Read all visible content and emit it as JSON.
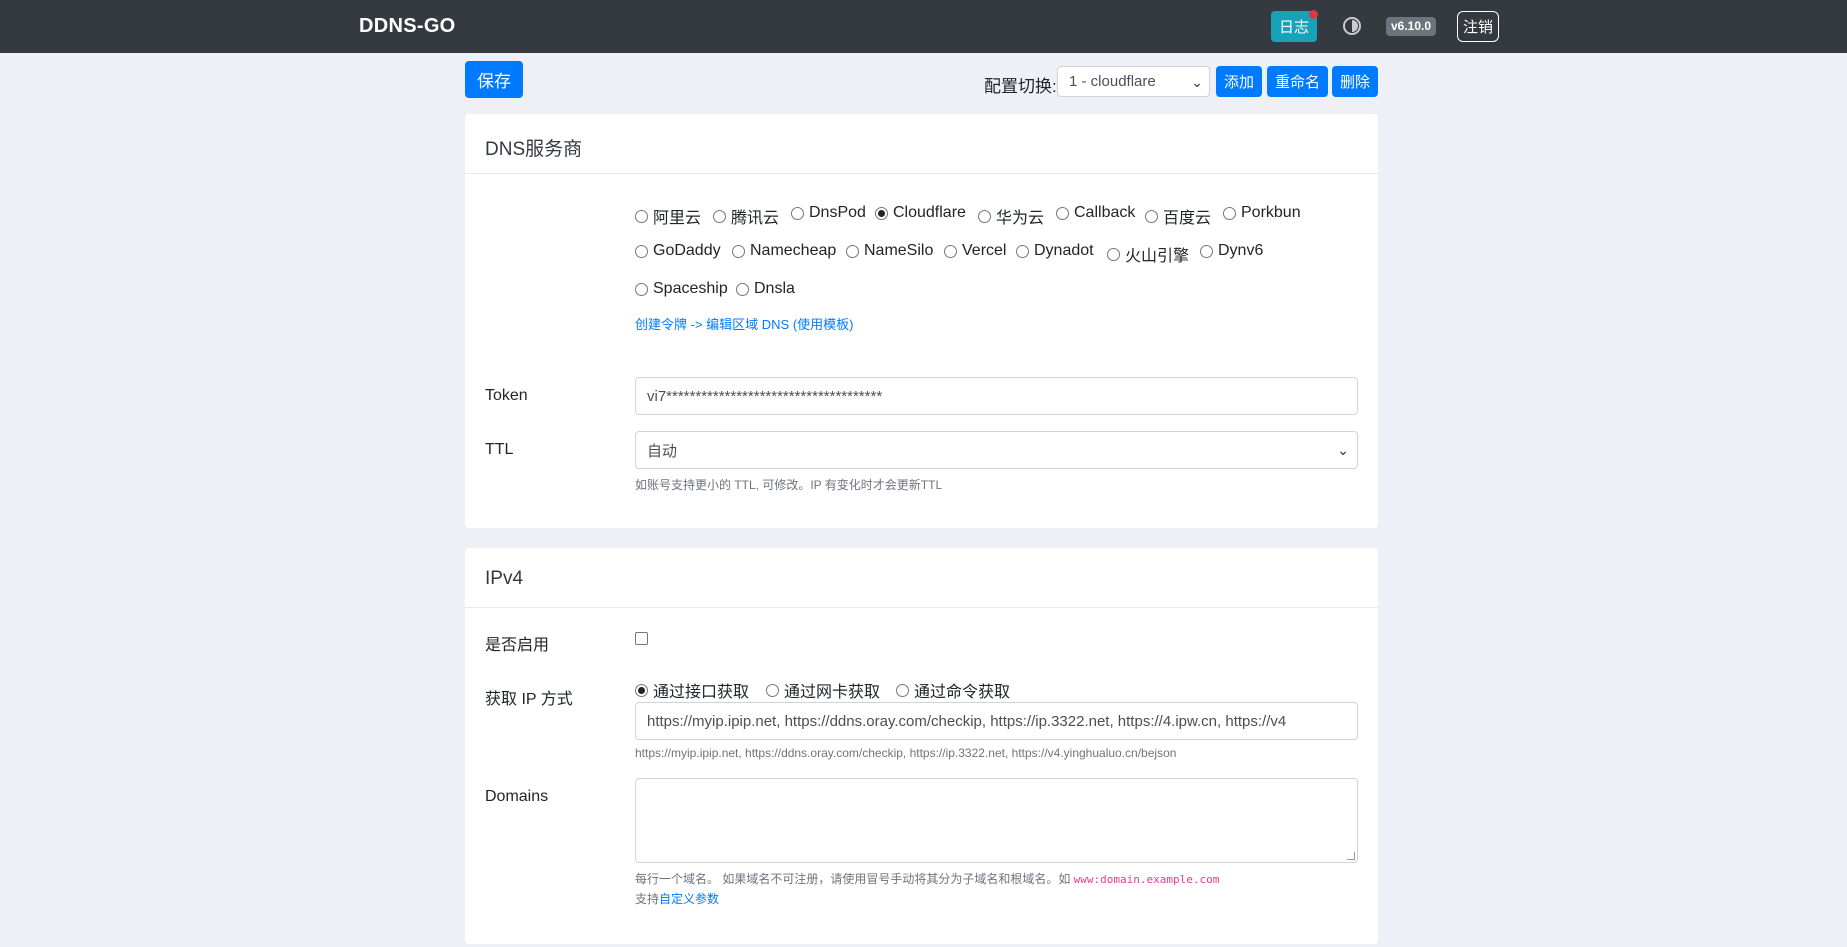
{
  "navbar": {
    "brand": "DDNS-GO",
    "log_label": "日志",
    "version": "v6.10.0",
    "logout_label": "注销"
  },
  "toolbar": {
    "save_label": "保存",
    "config_label": "配置切换:",
    "config_value": "1 - cloudflare",
    "add_label": "添加",
    "rename_label": "重命名",
    "delete_label": "删除"
  },
  "dns_card": {
    "title": "DNS服务商",
    "providers": [
      {
        "label": "阿里云",
        "selected": false
      },
      {
        "label": "腾讯云",
        "selected": false
      },
      {
        "label": "DnsPod",
        "selected": false
      },
      {
        "label": "Cloudflare",
        "selected": true
      },
      {
        "label": "华为云",
        "selected": false
      },
      {
        "label": "Callback",
        "selected": false
      },
      {
        "label": "百度云",
        "selected": false
      },
      {
        "label": "Porkbun",
        "selected": false
      },
      {
        "label": "GoDaddy",
        "selected": false
      },
      {
        "label": "Namecheap",
        "selected": false
      },
      {
        "label": "NameSilo",
        "selected": false
      },
      {
        "label": "Vercel",
        "selected": false
      },
      {
        "label": "Dynadot",
        "selected": false
      },
      {
        "label": "火山引擎",
        "selected": false
      },
      {
        "label": "Dynv6",
        "selected": false
      },
      {
        "label": "Spaceship",
        "selected": false
      },
      {
        "label": "Dnsla",
        "selected": false
      }
    ],
    "token_link": "创建令牌 -> 编辑区域 DNS (使用模板)",
    "token_label": "Token",
    "token_value": "vi7*************************************",
    "ttl_label": "TTL",
    "ttl_value": "自动",
    "ttl_help": "如账号支持更小的 TTL, 可修改。IP 有变化时才会更新TTL"
  },
  "ipv4_card": {
    "title": "IPv4",
    "enabled_label": "是否启用",
    "enabled": false,
    "get_ip_label": "获取 IP 方式",
    "methods": [
      {
        "label": "通过接口获取",
        "selected": true
      },
      {
        "label": "通过网卡获取",
        "selected": false
      },
      {
        "label": "通过命令获取",
        "selected": false
      }
    ],
    "url_value": "https://myip.ipip.net, https://ddns.oray.com/checkip, https://ip.3322.net, https://4.ipw.cn, https://v4",
    "url_help": "https://myip.ipip.net, https://ddns.oray.com/checkip, https://ip.3322.net, https://v4.yinghualuo.cn/bejson",
    "domains_label": "Domains",
    "domains_value": "",
    "domains_help_text": "每行一个域名。 如果域名不可注册，请使用冒号手动将其分为子域名和根域名。如 ",
    "domains_help_example": "www:domain.example.com",
    "domains_support_prefix": "支持",
    "domains_support_link": "自定义参数"
  }
}
